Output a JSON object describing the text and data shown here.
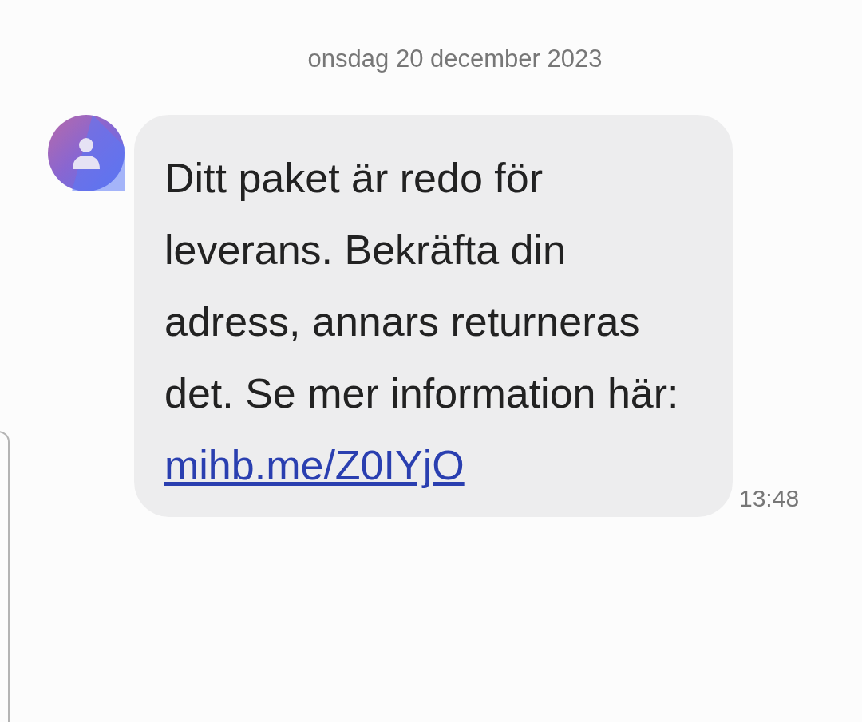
{
  "date_header": "onsdag 20 december 2023",
  "messages": [
    {
      "text": "Ditt paket är redo för leverans. Bekräfta din adress, annars returneras det. Se mer information här:",
      "link": "mihb.me/Z0IYjO",
      "time": "13:48"
    }
  ]
}
